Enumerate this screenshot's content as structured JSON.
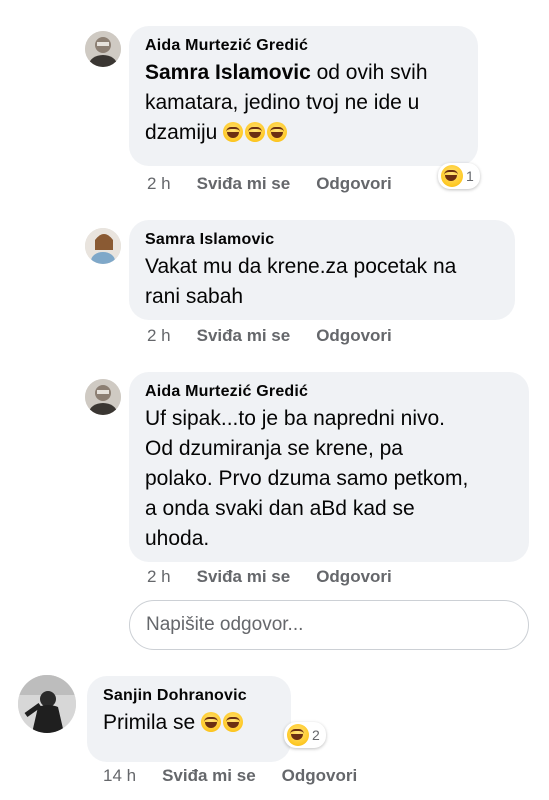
{
  "comments": [
    {
      "author": "Aida Murtezić Gredić",
      "mention": "Samra Islamovic",
      "text_lines": [
        "od ovih svih",
        "kamatara, jedino tvoj ne ide u",
        "dzamiju"
      ],
      "emoji_count": 3,
      "time": "2 h",
      "like_label": "Sviđa mi se",
      "reply_label": "Odgovori",
      "reaction_count": "1"
    },
    {
      "author": "Samra Islamovic",
      "text_lines": [
        "Vakat mu da krene.za pocetak na",
        "rani sabah"
      ],
      "time": "2 h",
      "like_label": "Sviđa mi se",
      "reply_label": "Odgovori"
    },
    {
      "author": "Aida Murtezić Gredić",
      "text_lines": [
        "Uf sipak...to je ba napredni nivo.",
        "Od dzumiranja se krene, pa",
        "polako. Prvo dzuma samo petkom,",
        "a onda svaki dan aBd kad se",
        "uhoda."
      ],
      "time": "2 h",
      "like_label": "Sviđa mi se",
      "reply_label": "Odgovori"
    }
  ],
  "reply_input": {
    "placeholder": "Napišite odgovor..."
  },
  "top_comment": {
    "author": "Sanjin Dohranovic",
    "text": "Primila se",
    "emoji_count": 2,
    "time": "14 h",
    "like_label": "Sviđa mi se",
    "reply_label": "Odgovori",
    "reaction_count": "2"
  },
  "colors": {
    "bubble": "#f0f2f5",
    "meta": "#65676b",
    "text": "#050505"
  },
  "icons": [
    "laughing-emoji-icon",
    "haha-reaction-icon"
  ]
}
